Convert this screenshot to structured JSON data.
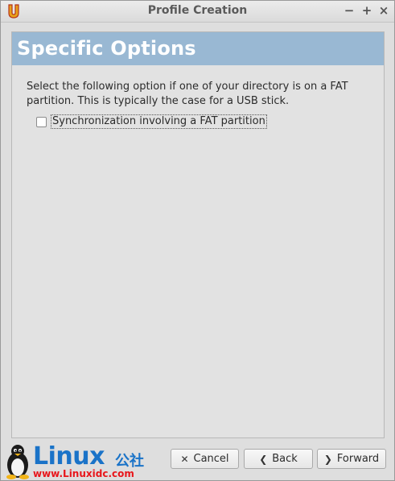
{
  "window": {
    "title": "Profile Creation",
    "controls": {
      "minimize": "−",
      "maximize": "+",
      "close": "×"
    }
  },
  "page": {
    "heading": "Specific Options",
    "description": "Select the following option if one of your directory is on a FAT partition.  This is typically the case for a USB stick.",
    "option": {
      "label": "Synchronization involving a FAT partition",
      "checked": false
    }
  },
  "buttons": {
    "cancel": {
      "label": "Cancel",
      "icon": "close-icon"
    },
    "back": {
      "label": "Back",
      "icon": "chevron-left-icon"
    },
    "forward": {
      "label": "Forward",
      "icon": "chevron-right-icon"
    }
  },
  "watermark": {
    "brand": "Linux",
    "brand_cn": "公社",
    "url": "www.Linuxidc.com"
  },
  "colors": {
    "banner": "#99b8d3",
    "watermark_blue": "#1a73c8",
    "watermark_red": "#e8161b"
  }
}
